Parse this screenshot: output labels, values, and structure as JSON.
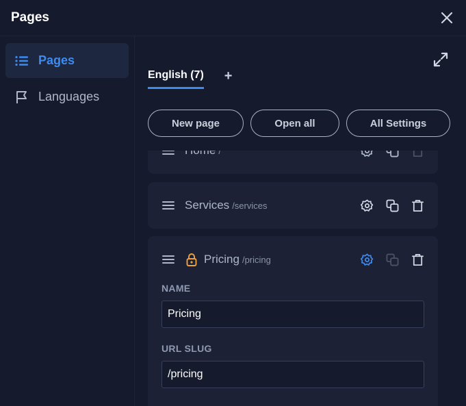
{
  "header": {
    "title": "Pages"
  },
  "sidebar": {
    "items": [
      {
        "label": "Pages",
        "icon": "list-icon",
        "active": true
      },
      {
        "label": "Languages",
        "icon": "flag-icon",
        "active": false
      }
    ]
  },
  "main": {
    "tabs": [
      {
        "label": "English (7)",
        "active": true
      }
    ],
    "add_tab_label": "+",
    "buttons": {
      "new_page": "New page",
      "open_all": "Open all",
      "all_settings": "All Settings"
    },
    "pages": [
      {
        "name": "Home",
        "slug": "/"
      },
      {
        "name": "Services",
        "slug": "/services"
      },
      {
        "name": "Pricing",
        "slug": "/pricing",
        "locked": true,
        "expanded": true,
        "form": {
          "name_label": "NAME",
          "name_value": "Pricing",
          "slug_label": "URL SLUG",
          "slug_value": "/pricing"
        }
      }
    ]
  },
  "colors": {
    "accent": "#3d8bf0",
    "lock": "#f0a23a",
    "background": "#151a2c",
    "card": "#1c2135"
  }
}
